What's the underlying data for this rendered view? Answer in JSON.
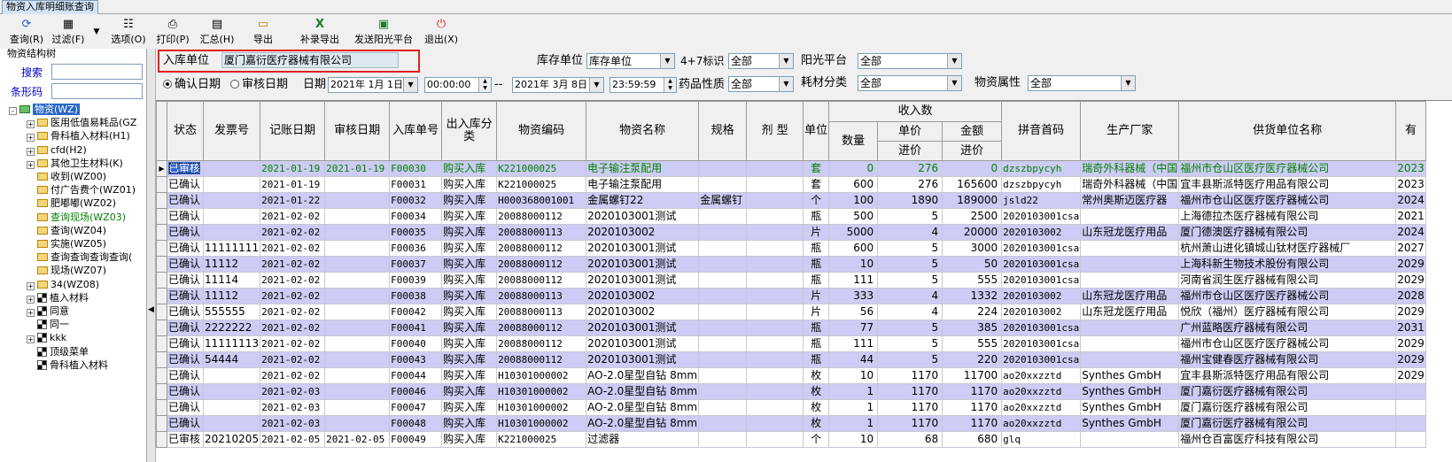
{
  "window": {
    "tab_title": "物资入库明细账查询"
  },
  "toolbar": [
    {
      "label": "查询(R)",
      "icon": "refresh-icon"
    },
    {
      "label": "过滤(F)",
      "icon": "filter-icon"
    },
    {
      "label": "选项(O)",
      "icon": "options-icon"
    },
    {
      "label": "打印(P)",
      "icon": "print-icon"
    },
    {
      "label": "汇总(H)",
      "icon": "summary-icon"
    },
    {
      "label": "导出",
      "icon": "export-icon"
    },
    {
      "label": "补录导出",
      "icon": "excel-icon"
    },
    {
      "label": "发送阳光平台",
      "icon": "send-icon"
    },
    {
      "label": "退出(X)",
      "icon": "exit-icon"
    }
  ],
  "left": {
    "title": "物资结构树",
    "search_label": "搜索",
    "search_value": "",
    "barcode_label": "条形码",
    "barcode_value": "",
    "tree": [
      {
        "label": "物资(WZ)",
        "level": 0,
        "toggle": "-",
        "icon": "folder",
        "selected": true
      },
      {
        "label": "医用低值易耗品(GZ",
        "level": 1,
        "toggle": "+",
        "icon": "folder"
      },
      {
        "label": "骨科植入材料(H1)",
        "level": 1,
        "toggle": "+",
        "icon": "folder"
      },
      {
        "label": "cfd(H2)",
        "level": 1,
        "toggle": "+",
        "icon": "folder"
      },
      {
        "label": "其他卫生材料(K)",
        "level": 1,
        "toggle": "+",
        "icon": "folder"
      },
      {
        "label": "收到(WZ00)",
        "level": 1,
        "toggle": "",
        "icon": "folder"
      },
      {
        "label": "付广告费个(WZ01)",
        "level": 1,
        "toggle": "",
        "icon": "folder"
      },
      {
        "label": "肥嘟嘟(WZ02)",
        "level": 1,
        "toggle": "",
        "icon": "folder"
      },
      {
        "label": "查询现场(WZ03)",
        "level": 1,
        "toggle": "",
        "icon": "folder",
        "green": true
      },
      {
        "label": "查询(WZ04)",
        "level": 1,
        "toggle": "",
        "icon": "folder"
      },
      {
        "label": "实施(WZ05)",
        "level": 1,
        "toggle": "",
        "icon": "folder"
      },
      {
        "label": "查询查询查询查询(",
        "level": 1,
        "toggle": "",
        "icon": "folder"
      },
      {
        "label": "现场(WZ07)",
        "level": 1,
        "toggle": "",
        "icon": "folder"
      },
      {
        "label": "34(WZ08)",
        "level": 1,
        "toggle": "+",
        "icon": "folder"
      },
      {
        "label": "植入材料",
        "level": 1,
        "toggle": "+",
        "icon": "grid"
      },
      {
        "label": "同意",
        "level": 1,
        "toggle": "+",
        "icon": "grid"
      },
      {
        "label": "同一",
        "level": 1,
        "toggle": "",
        "icon": "grid"
      },
      {
        "label": "kkk",
        "level": 1,
        "toggle": "+",
        "icon": "grid"
      },
      {
        "label": "顶级菜单",
        "level": 1,
        "toggle": "",
        "icon": "grid"
      },
      {
        "label": "骨科植入材料",
        "level": 1,
        "toggle": "",
        "icon": "grid"
      }
    ]
  },
  "filters": {
    "inbound_unit_label": "入库单位",
    "inbound_unit_value": "厦门嘉衍医疗器械有限公司",
    "stock_unit_label": "库存单位",
    "stock_unit_value": "库存单位",
    "flag_label": "4+7标识",
    "flag_value": "全部",
    "sunshine_label": "阳光平台",
    "sunshine_value": "全部",
    "radio_confirm": "确认日期",
    "radio_audit": "审核日期",
    "date_label": "日期",
    "date_from": "2021年 1月 1日",
    "time_from": "00:00:00",
    "date_sep": "--",
    "date_to": "2021年 3月 8日",
    "time_to": "23:59:59",
    "drug_label": "药品性质",
    "drug_value": "全部",
    "consume_label": "耗材分类",
    "consume_value": "全部",
    "attr_label": "物资属性",
    "attr_value": "全部"
  },
  "grid": {
    "headers": {
      "status": "状态",
      "invoice": "发票号",
      "post_date": "记账日期",
      "audit_date": "审核日期",
      "doc_no": "入库单号",
      "io_type": "出入库分类",
      "code": "物资编码",
      "name": "物资名称",
      "spec": "规格",
      "form": "剂 型",
      "unit": "单位",
      "income": "收入数",
      "qty": "数量",
      "price": "单价",
      "price_sub": "进价",
      "amount": "金额",
      "amount_sub": "进价",
      "pinyin": "拼音首码",
      "maker": "生产厂家",
      "supplier": "供货单位名称",
      "valid": "有"
    },
    "rows": [
      [
        "已审核",
        "",
        "2021-01-19",
        "2021-01-19",
        "F00030",
        "购买入库",
        "K221000025",
        "电子输注泵配用",
        "",
        "",
        "套",
        "0",
        "276",
        "0",
        "dzszbpycyh",
        "瑞奇外科器械（中国",
        "福州市仓山区医疗医疗器械公司",
        "2023"
      ],
      [
        "已确认",
        "",
        "2021-01-19",
        "",
        "F00031",
        "购买入库",
        "K221000025",
        "电子输注泵配用",
        "",
        "",
        "套",
        "600",
        "276",
        "165600",
        "dzszbpycyh",
        "瑞奇外科器械（中国",
        "宜丰县斯派特医疗用品有限公司",
        "2023"
      ],
      [
        "已确认",
        "",
        "2021-01-22",
        "",
        "F00032",
        "购买入库",
        "H000368001001",
        "金属螺钉22",
        "金属螺钉",
        "",
        "个",
        "100",
        "1890",
        "189000",
        "jsld22",
        "常州奥斯迈医疗器",
        "福州市仓山区医疗医疗器械公司",
        "2024"
      ],
      [
        "已确认",
        "",
        "2021-02-02",
        "",
        "F00034",
        "购买入库",
        "20088000112",
        "2020103001测试",
        "",
        "",
        "瓶",
        "500",
        "5",
        "2500",
        "2020103001csa",
        "",
        "上海德拉杰医疗器械有限公司",
        "2021"
      ],
      [
        "已确认",
        "",
        "2021-02-02",
        "",
        "F00035",
        "购买入库",
        "20088000113",
        "2020103002",
        "",
        "",
        "片",
        "5000",
        "4",
        "20000",
        "2020103002",
        "山东冠龙医疗用品",
        "厦门德澳医疗器械有限公司",
        "2024"
      ],
      [
        "已确认",
        "11111111",
        "2021-02-02",
        "",
        "F00036",
        "购买入库",
        "20088000112",
        "2020103001测试",
        "",
        "",
        "瓶",
        "600",
        "5",
        "3000",
        "2020103001csa",
        "",
        "杭州萧山进化镇城山钛材医疗器械厂",
        "2027"
      ],
      [
        "已确认",
        "11112",
        "2021-02-02",
        "",
        "F00037",
        "购买入库",
        "20088000112",
        "2020103001测试",
        "",
        "",
        "瓶",
        "10",
        "5",
        "50",
        "2020103001csa",
        "",
        "上海科新生物技术股份有限公司",
        "2029"
      ],
      [
        "已确认",
        "11114",
        "2021-02-02",
        "",
        "F00039",
        "购买入库",
        "20088000112",
        "2020103001测试",
        "",
        "",
        "瓶",
        "111",
        "5",
        "555",
        "2020103001csa",
        "",
        "河南省润生医疗器械有限公司",
        "2029"
      ],
      [
        "已确认",
        "11112",
        "2021-02-02",
        "",
        "F00038",
        "购买入库",
        "20088000113",
        "2020103002",
        "",
        "",
        "片",
        "333",
        "4",
        "1332",
        "2020103002",
        "山东冠龙医疗用品",
        "福州市仓山区医疗医疗器械公司",
        "2028"
      ],
      [
        "已确认",
        "555555",
        "2021-02-02",
        "",
        "F00042",
        "购买入库",
        "20088000113",
        "2020103002",
        "",
        "",
        "片",
        "56",
        "4",
        "224",
        "2020103002",
        "山东冠龙医疗用品",
        "悦欣（福州）医疗器械有限公司",
        "2029"
      ],
      [
        "已确认",
        "2222222",
        "2021-02-02",
        "",
        "F00041",
        "购买入库",
        "20088000112",
        "2020103001测试",
        "",
        "",
        "瓶",
        "77",
        "5",
        "385",
        "2020103001csa",
        "",
        "广州蓝略医疗器械有限公司",
        "2031"
      ],
      [
        "已确认",
        "11111113",
        "2021-02-02",
        "",
        "F00040",
        "购买入库",
        "20088000112",
        "2020103001测试",
        "",
        "",
        "瓶",
        "111",
        "5",
        "555",
        "2020103001csa",
        "",
        "福州市仓山区医疗医疗器械公司",
        "2029"
      ],
      [
        "已确认",
        "54444",
        "2021-02-02",
        "",
        "F00043",
        "购买入库",
        "20088000112",
        "2020103001测试",
        "",
        "",
        "瓶",
        "44",
        "5",
        "220",
        "2020103001csa",
        "",
        "福州宝健春医疗器械有限公司",
        "2029"
      ],
      [
        "已确认",
        "",
        "2021-02-02",
        "",
        "F00044",
        "购买入库",
        "H10301000002",
        "AO-2.0星型自钻 8mm",
        "",
        "",
        "枚",
        "10",
        "1170",
        "11700",
        "ao20xxzztd",
        "Synthes GmbH",
        "宜丰县斯派特医疗用品有限公司",
        "2029"
      ],
      [
        "已确认",
        "",
        "2021-02-03",
        "",
        "F00046",
        "购买入库",
        "H10301000002",
        "AO-2.0星型自钻 8mm",
        "",
        "",
        "枚",
        "1",
        "1170",
        "1170",
        "ao20xxzztd",
        "Synthes GmbH",
        "厦门嘉衍医疗器械有限公司",
        ""
      ],
      [
        "已确认",
        "",
        "2021-02-03",
        "",
        "F00047",
        "购买入库",
        "H10301000002",
        "AO-2.0星型自钻 8mm",
        "",
        "",
        "枚",
        "1",
        "1170",
        "1170",
        "ao20xxzztd",
        "Synthes GmbH",
        "厦门嘉衍医疗器械有限公司",
        ""
      ],
      [
        "已确认",
        "",
        "2021-02-03",
        "",
        "F00048",
        "购买入库",
        "H10301000002",
        "AO-2.0星型自钻 8mm",
        "",
        "",
        "枚",
        "1",
        "1170",
        "1170",
        "ao20xxzztd",
        "Synthes GmbH",
        "厦门嘉衍医疗器械有限公司",
        ""
      ],
      [
        "已审核",
        "20210205",
        "2021-02-05",
        "2021-02-05",
        "F00049",
        "购买入库",
        "K221000025",
        "过滤器",
        "",
        "",
        "个",
        "10",
        "68",
        "680",
        "glq",
        "",
        "福州仓百富医疗科技有限公司",
        ""
      ]
    ]
  },
  "colors": {
    "accent": "#2a67c6",
    "row_alt": "#ccccf4",
    "highlight_border": "#e02020",
    "green_text": "#008000"
  }
}
